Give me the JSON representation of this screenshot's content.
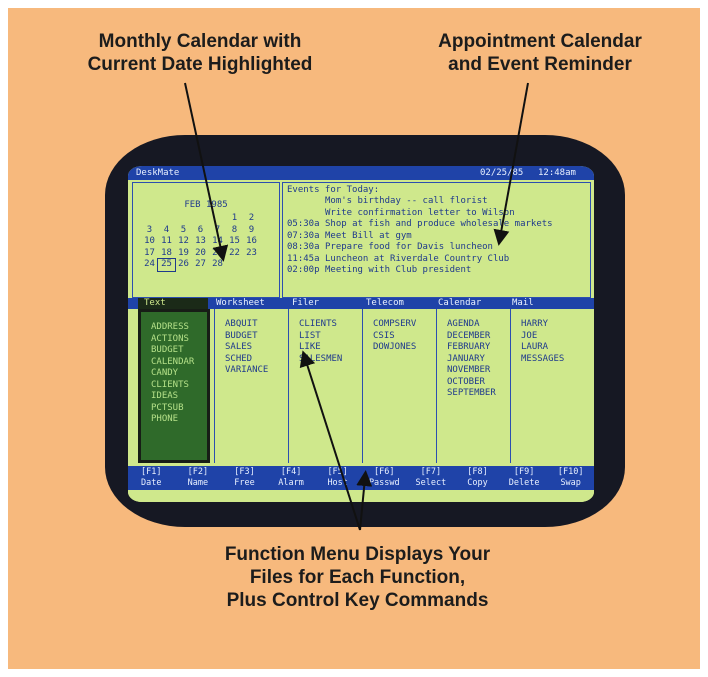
{
  "captions": {
    "calendar": [
      "Monthly Calendar with",
      "Current Date Highlighted"
    ],
    "appointment": [
      "Appointment Calendar",
      "and Event Reminder"
    ],
    "function_menu": [
      "Function Menu Displays Your",
      "Files for Each Function,",
      "Plus Control Key Commands"
    ]
  },
  "topbar": {
    "app": "DeskMate",
    "date": "02/25/85",
    "time": "12:48am"
  },
  "calendar": {
    "month": "FEB 1985",
    "rows": [
      [
        "",
        "",
        "",
        "",
        "",
        "1",
        "2"
      ],
      [
        "3",
        "4",
        "5",
        "6",
        "7",
        "8",
        "9"
      ],
      [
        "10",
        "11",
        "12",
        "13",
        "14",
        "15",
        "16"
      ],
      [
        "17",
        "18",
        "19",
        "20",
        "21",
        "22",
        "23"
      ],
      [
        "24",
        "25",
        "26",
        "27",
        "28",
        "",
        ""
      ]
    ],
    "highlighted": "25"
  },
  "events": {
    "heading": "Events for Today:",
    "items": [
      {
        "time": "",
        "text": "Mom's birthday -- call florist"
      },
      {
        "time": "",
        "text": "Write confirmation letter to Wilson"
      },
      {
        "time": "05:30a",
        "text": "Shop at fish and produce wholesale markets"
      },
      {
        "time": "07:30a",
        "text": "Meet Bill at gym"
      },
      {
        "time": "08:30a",
        "text": "Prepare food for Davis luncheon"
      },
      {
        "time": "11:45a",
        "text": "Luncheon at Riverdale Country Club"
      },
      {
        "time": "02:00p",
        "text": "Meeting with Club president"
      }
    ]
  },
  "menu": {
    "headers": [
      "Text",
      "Worksheet",
      "Filer",
      "Telecom",
      "Calendar",
      "Mail"
    ],
    "columns": [
      [
        "ADDRESS",
        "ACTIONS",
        "BUDGET",
        "CALENDAR",
        "CANDY",
        "CLIENTS",
        "IDEAS",
        "PCTSUB",
        "PHONE"
      ],
      [
        "ABQUIT",
        "BUDGET",
        "SALES",
        "SCHED",
        "VARIANCE"
      ],
      [
        "CLIENTS",
        "LIST",
        "LIKE",
        "SALESMEN"
      ],
      [
        "COMPSERV",
        "CSIS",
        "DOWJONES"
      ],
      [
        "AGENDA",
        "DECEMBER",
        "FEBRUARY",
        "JANUARY",
        "NOVEMBER",
        "OCTOBER",
        "SEPTEMBER"
      ],
      [
        "HARRY",
        "JOE",
        "LAURA",
        "MESSAGES"
      ]
    ]
  },
  "fkeys": [
    {
      "key": "[F1]",
      "label": "Date"
    },
    {
      "key": "[F2]",
      "label": "Name"
    },
    {
      "key": "[F3]",
      "label": "Free"
    },
    {
      "key": "[F4]",
      "label": "Alarm"
    },
    {
      "key": "[F5]",
      "label": "Host"
    },
    {
      "key": "[F6]",
      "label": "Passwd"
    },
    {
      "key": "[F7]",
      "label": "Select"
    },
    {
      "key": "[F8]",
      "label": "Copy"
    },
    {
      "key": "[F9]",
      "label": "Delete"
    },
    {
      "key": "[F10]",
      "label": "Swap"
    }
  ],
  "colors": {
    "background": "#f7b97d",
    "screen": "#cfe88c",
    "screen_bar": "#1f43a8",
    "text_blue": "#1f3a8c",
    "active_column": "#2f6a2a"
  }
}
